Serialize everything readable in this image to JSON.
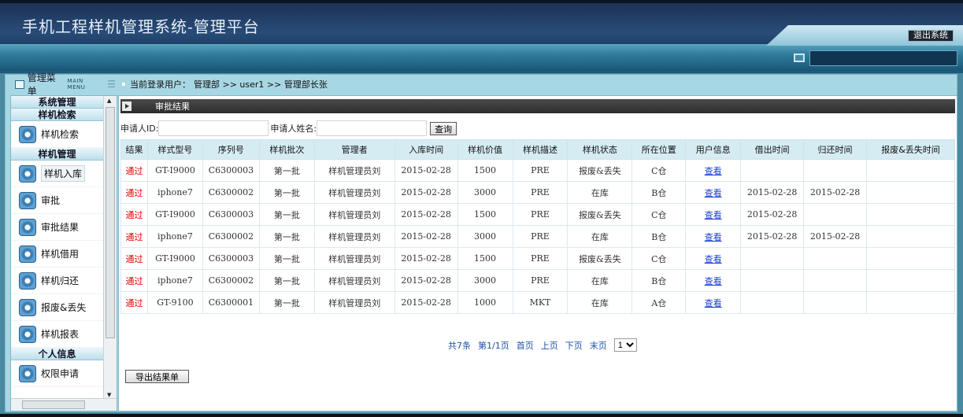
{
  "header": {
    "title": "手机工程样机管理系统-管理平台",
    "logout_label": "退出系统"
  },
  "sidebar": {
    "title": "管理菜单",
    "title_en": "MAIN MENU",
    "sections": [
      {
        "title": "系统管理",
        "items": []
      },
      {
        "title": "样机检索",
        "items": [
          {
            "label": "样机检索"
          }
        ]
      },
      {
        "title": "样机管理",
        "items": [
          {
            "label": "样机入库"
          },
          {
            "label": "审批"
          },
          {
            "label": "审批结果"
          },
          {
            "label": "样机借用"
          },
          {
            "label": "样机归还"
          },
          {
            "label": "报废&丢失"
          },
          {
            "label": "样机报表"
          }
        ]
      },
      {
        "title": "个人信息",
        "items": [
          {
            "label": "权限申请"
          }
        ]
      }
    ]
  },
  "breadcrumb": {
    "prefix": "当前登录用户：",
    "text": "管理部 >> user1 >> 管理部长张"
  },
  "content": {
    "panel_title": "审批结果",
    "filter": {
      "id_label": "申请人ID:",
      "id_value": "",
      "name_label": "申请人姓名:",
      "name_value": "",
      "query_label": "查询"
    },
    "columns": [
      "结果",
      "样式型号",
      "序列号",
      "样机批次",
      "管理者",
      "入库时间",
      "样机价值",
      "样机描述",
      "样机状态",
      "所在位置",
      "用户信息",
      "借出时间",
      "归还时间",
      "报废&丢失时间"
    ],
    "rows": [
      [
        "通过",
        "GT-I9000",
        "C6300003",
        "第一批",
        "样机管理员刘",
        "2015-02-28",
        "1500",
        "PRE",
        "报废&丢失",
        "C仓",
        "查看",
        "",
        "",
        ""
      ],
      [
        "通过",
        "iphone7",
        "C6300002",
        "第一批",
        "样机管理员刘",
        "2015-02-28",
        "3000",
        "PRE",
        "在库",
        "B仓",
        "查看",
        "2015-02-28",
        "2015-02-28",
        ""
      ],
      [
        "通过",
        "GT-I9000",
        "C6300003",
        "第一批",
        "样机管理员刘",
        "2015-02-28",
        "1500",
        "PRE",
        "报废&丢失",
        "C仓",
        "查看",
        "2015-02-28",
        "",
        ""
      ],
      [
        "通过",
        "iphone7",
        "C6300002",
        "第一批",
        "样机管理员刘",
        "2015-02-28",
        "3000",
        "PRE",
        "在库",
        "B仓",
        "查看",
        "2015-02-28",
        "2015-02-28",
        ""
      ],
      [
        "通过",
        "GT-I9000",
        "C6300003",
        "第一批",
        "样机管理员刘",
        "2015-02-28",
        "1500",
        "PRE",
        "报废&丢失",
        "C仓",
        "查看",
        "",
        "",
        ""
      ],
      [
        "通过",
        "iphone7",
        "C6300002",
        "第一批",
        "样机管理员刘",
        "2015-02-28",
        "3000",
        "PRE",
        "在库",
        "B仓",
        "查看",
        "",
        "",
        ""
      ],
      [
        "通过",
        "GT-9100",
        "C6300001",
        "第一批",
        "样机管理员刘",
        "2015-02-28",
        "1000",
        "MKT",
        "在库",
        "A仓",
        "查看",
        "",
        "",
        ""
      ]
    ],
    "pager": {
      "total": "共7条",
      "page_info": "第1/1页",
      "first": "首页",
      "prev": "上页",
      "next": "下页",
      "last": "末页",
      "selected_page": "1"
    },
    "export_label": "导出结果单"
  },
  "colors": {
    "header_dark": "#1c2f52",
    "frame_bg": "#a8d7e4",
    "table_header_bg": "#d6ecf3",
    "pass_red": "#e00000",
    "link_blue": "#1a3fd6"
  }
}
